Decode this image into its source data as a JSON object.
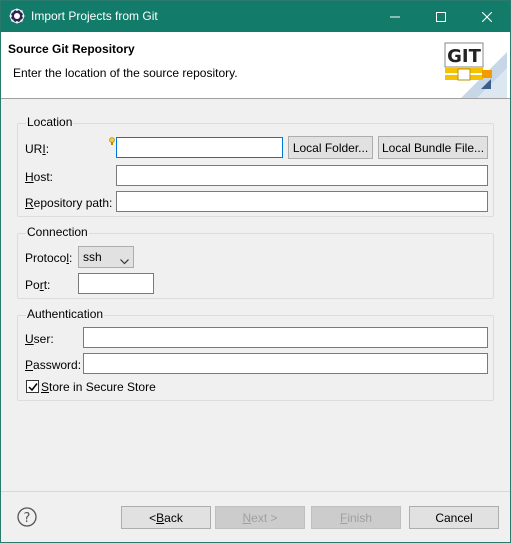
{
  "window": {
    "title": "Import Projects from Git",
    "titlebar_color": "#127b6a"
  },
  "header": {
    "title": "Source Git Repository",
    "description": "Enter the location of the source repository.",
    "logo_text": "GIT"
  },
  "location": {
    "group_label": "Location",
    "uri_label_pre": "UR",
    "uri_label_accel": "I",
    "uri_label_post": ":",
    "uri_value": "",
    "local_folder_button": "Local Folder...",
    "local_bundle_button": "Local Bundle File...",
    "host_label_accel": "H",
    "host_label_post": "ost:",
    "host_value": "",
    "repo_label_accel": "R",
    "repo_label_post": "epository path:",
    "repo_value": ""
  },
  "connection": {
    "group_label": "Connection",
    "protocol_label_pre": "Protoco",
    "protocol_label_accel": "l",
    "protocol_label_post": ":",
    "protocol_value": "ssh",
    "port_label_pre": "Po",
    "port_label_accel": "r",
    "port_label_post": "t:",
    "port_value": ""
  },
  "authentication": {
    "group_label": "Authentication",
    "user_label_accel": "U",
    "user_label_post": "ser:",
    "user_value": "",
    "password_label_accel": "P",
    "password_label_post": "assword:",
    "password_value": "",
    "store_label_accel": "S",
    "store_label_post": "tore in Secure Store",
    "store_checked": true
  },
  "footer": {
    "back_pre": "< ",
    "back_accel": "B",
    "back_post": "ack",
    "next_accel": "N",
    "next_post": "ext >",
    "finish_accel": "F",
    "finish_post": "inish",
    "cancel": "Cancel"
  },
  "icons": {
    "app": "eclipse-gear-icon",
    "minimize": "minimize-icon",
    "maximize": "maximize-icon",
    "close": "close-icon",
    "help": "help-icon",
    "hint": "content-assist-bulb-icon",
    "banner": "git-logo-icon"
  }
}
